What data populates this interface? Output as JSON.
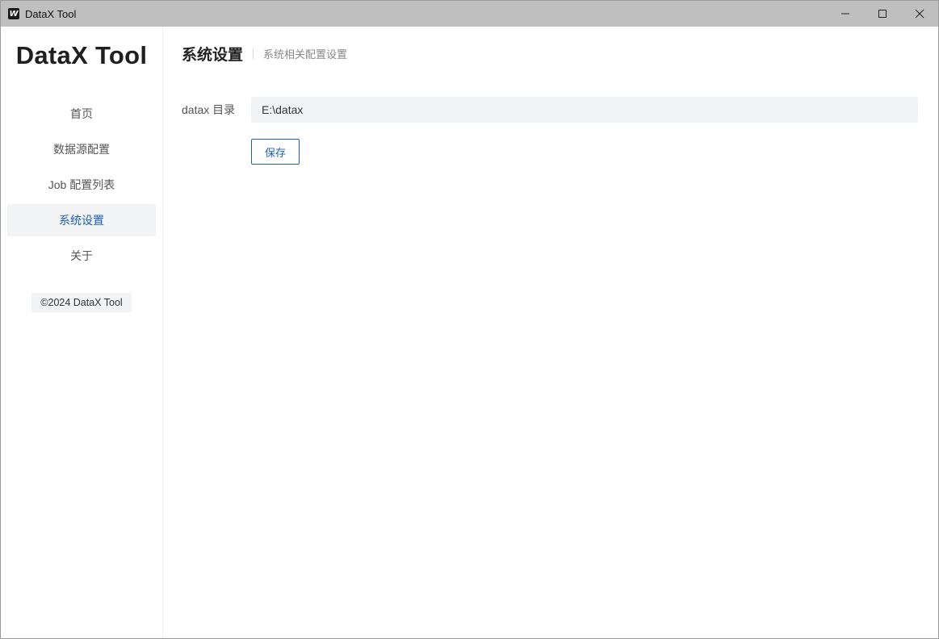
{
  "window": {
    "app_icon_letter": "W",
    "title": "DataX Tool",
    "controls": [
      "minimize-icon",
      "maximize-icon",
      "close-icon"
    ]
  },
  "sidebar": {
    "logo": "DataX Tool",
    "items": [
      {
        "label": "首页",
        "active": false
      },
      {
        "label": "数据源配置",
        "active": false
      },
      {
        "label": "Job 配置列表",
        "active": false
      },
      {
        "label": "系统设置",
        "active": true
      },
      {
        "label": "关于",
        "active": false
      }
    ],
    "copyright": "©2024 DataX Tool"
  },
  "main": {
    "title": "系统设置",
    "subtitle": "系统相关配置设置",
    "form": {
      "datax_dir_label": "datax 目录",
      "datax_dir_value": "E:\\datax",
      "save_label": "保存"
    }
  },
  "colors": {
    "accent": "#1f5fb0",
    "titlebar": "#bfbfbf",
    "active_bg": "#f2f3f5"
  }
}
